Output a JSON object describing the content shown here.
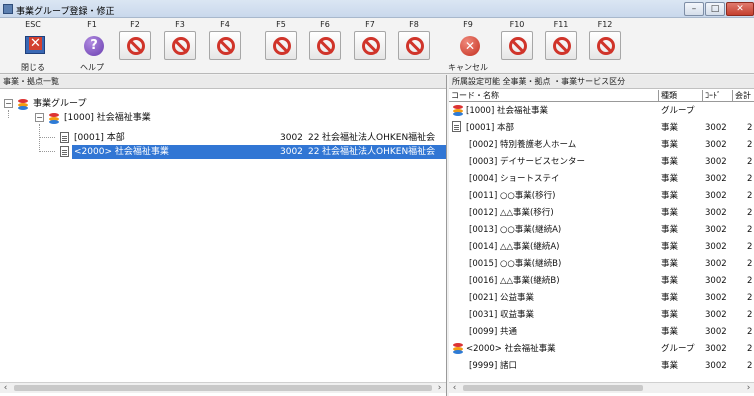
{
  "window": {
    "title": "事業グループ登録・修正",
    "min_glyph": "–",
    "max_glyph": "□",
    "close_glyph": "✕"
  },
  "toolbar": {
    "keys": [
      {
        "key": "ESC",
        "label": "閉じる",
        "icon": "close-window-icon"
      },
      {
        "key": "F1",
        "label": "ヘルプ",
        "icon": "help-icon"
      },
      {
        "key": "F2",
        "label": "",
        "icon": "disabled-icon"
      },
      {
        "key": "F3",
        "label": "",
        "icon": "disabled-icon"
      },
      {
        "key": "F4",
        "label": "",
        "icon": "disabled-icon"
      },
      {
        "key": "F5",
        "label": "",
        "icon": "disabled-icon"
      },
      {
        "key": "F6",
        "label": "",
        "icon": "disabled-icon"
      },
      {
        "key": "F7",
        "label": "",
        "icon": "disabled-icon"
      },
      {
        "key": "F8",
        "label": "",
        "icon": "disabled-icon"
      },
      {
        "key": "F9",
        "label": "キャンセル",
        "icon": "cancel-icon"
      },
      {
        "key": "F10",
        "label": "",
        "icon": "disabled-icon"
      },
      {
        "key": "F11",
        "label": "",
        "icon": "disabled-icon"
      },
      {
        "key": "F12",
        "label": "",
        "icon": "disabled-icon"
      }
    ],
    "help_glyph": "?",
    "cancel_glyph": "✕"
  },
  "left_panel": {
    "header": "事業・拠点一覧",
    "tree": [
      {
        "expander": "−",
        "label": "事業グループ",
        "code": "",
        "num": "",
        "org": ""
      },
      {
        "expander": "−",
        "label": "[1000] 社会福祉事業",
        "code": "",
        "num": "",
        "org": ""
      },
      {
        "expander": "",
        "label": "[0001] 本部",
        "code": "3002",
        "num": "22",
        "org": "社会福祉法人OHKEN福祉会"
      },
      {
        "expander": "",
        "label": "<2000> 社会福祉事業",
        "code": "3002",
        "num": "22",
        "org": "社会福祉法人OHKEN福祉会"
      }
    ]
  },
  "right_panel": {
    "header": "所属設定可能 全事業・拠点 ・事業サービス区分",
    "columns": [
      "コード・名称",
      "種類",
      "ｺｰﾄﾞ",
      "会計"
    ],
    "rows": [
      {
        "name": "[1000] 社会福祉事業",
        "type": "グループ",
        "code": "",
        "acct": ""
      },
      {
        "name": "[0001] 本部",
        "type": "事業",
        "code": "3002",
        "acct": "2"
      },
      {
        "name": "[0002] 特別養護老人ホーム",
        "type": "事業",
        "code": "3002",
        "acct": "2"
      },
      {
        "name": "[0003] デイサービスセンター",
        "type": "事業",
        "code": "3002",
        "acct": "2"
      },
      {
        "name": "[0004] ショートステイ",
        "type": "事業",
        "code": "3002",
        "acct": "2"
      },
      {
        "name": "[0011] ○○事業(移行)",
        "type": "事業",
        "code": "3002",
        "acct": "2"
      },
      {
        "name": "[0012] △△事業(移行)",
        "type": "事業",
        "code": "3002",
        "acct": "2"
      },
      {
        "name": "[0013] ○○事業(継続A)",
        "type": "事業",
        "code": "3002",
        "acct": "2"
      },
      {
        "name": "[0014] △△事業(継続A)",
        "type": "事業",
        "code": "3002",
        "acct": "2"
      },
      {
        "name": "[0015] ○○事業(継続B)",
        "type": "事業",
        "code": "3002",
        "acct": "2"
      },
      {
        "name": "[0016] △△事業(継続B)",
        "type": "事業",
        "code": "3002",
        "acct": "2"
      },
      {
        "name": "[0021] 公益事業",
        "type": "事業",
        "code": "3002",
        "acct": "2"
      },
      {
        "name": "[0031] 収益事業",
        "type": "事業",
        "code": "3002",
        "acct": "2"
      },
      {
        "name": "[0099] 共通",
        "type": "事業",
        "code": "3002",
        "acct": "2"
      },
      {
        "name": "<2000> 社会福祉事業",
        "type": "グループ",
        "code": "3002",
        "acct": "2"
      },
      {
        "name": "[9999] 諸口",
        "type": "事業",
        "code": "3002",
        "acct": "2"
      }
    ]
  },
  "scroll": {
    "left": "‹",
    "right": "›"
  },
  "colors": {
    "selection": "#3176d4",
    "group_red": "#d33",
    "group_orange": "#f39c12",
    "group_blue": "#2e7bd6"
  }
}
